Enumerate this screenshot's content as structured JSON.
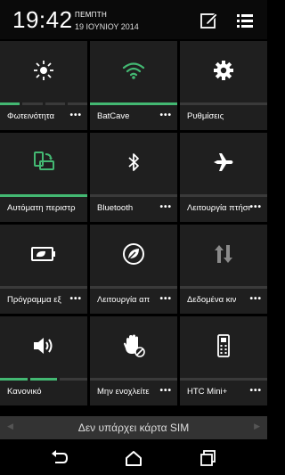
{
  "status": {
    "time": "19:42",
    "day": "ΠΕΜΠΤΗ",
    "date": "19 ΙΟΥΝΙΟΥ 2014"
  },
  "header_icons": [
    "edit-icon",
    "list-icon"
  ],
  "tiles": [
    {
      "label": "Φωτεινότητα",
      "icon": "brightness-icon",
      "more": "•••",
      "level": 0.25
    },
    {
      "label": "BatCave",
      "icon": "wifi-icon",
      "more": "•••",
      "active": true
    },
    {
      "label": "Ρυθμίσεις",
      "icon": "gear-icon",
      "more": ""
    },
    {
      "label": "Αυτόματη περιστρ",
      "icon": "auto-rotate-icon",
      "more": "",
      "active": true
    },
    {
      "label": "Bluetooth",
      "icon": "bluetooth-icon",
      "more": "•••",
      "active": false
    },
    {
      "label": "Λειτουργία πτήσης",
      "icon": "airplane-icon",
      "more": "•••",
      "active": false
    },
    {
      "label": "Πρόγραμμα εξ",
      "icon": "power-saver-icon",
      "more": "•••",
      "active": false
    },
    {
      "label": "Λειτουργία απ",
      "icon": "extreme-power-icon",
      "more": "•••",
      "active": false
    },
    {
      "label": "Δεδομένα κιν",
      "icon": "mobile-data-icon",
      "more": "•••",
      "active": false
    },
    {
      "label": "Κανονικό",
      "icon": "volume-icon",
      "more": "",
      "level": 0.66
    },
    {
      "label": "Μην ενοχλείτε",
      "icon": "do-not-disturb-icon",
      "more": "•••",
      "active": false
    },
    {
      "label": "HTC Mini+",
      "icon": "htc-mini-icon",
      "more": "•••",
      "active": false
    }
  ],
  "sim_message": "Δεν υπάρχει κάρτα SIM",
  "nav": [
    "back-icon",
    "home-icon",
    "recents-icon"
  ],
  "colors": {
    "accent": "#43b872",
    "tile": "#1f1f1f",
    "bar_off": "#3a3a3a"
  }
}
